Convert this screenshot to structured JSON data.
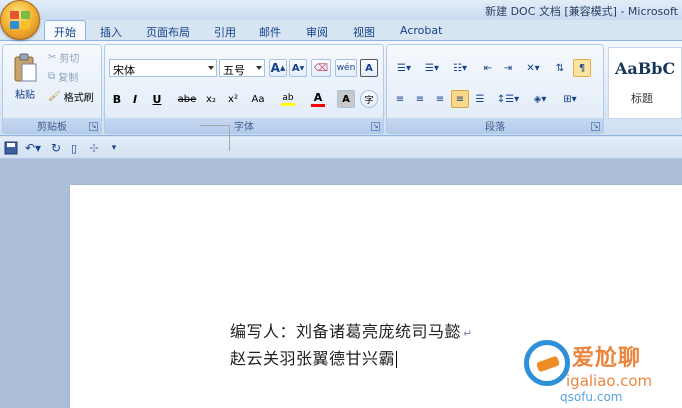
{
  "window": {
    "title": "新建 DOC 文档 [兼容模式] - Microsoft"
  },
  "tabs": [
    "开始",
    "插入",
    "页面布局",
    "引用",
    "邮件",
    "审阅",
    "视图",
    "Acrobat"
  ],
  "clipboard": {
    "paste": "粘贴",
    "cut": "剪切",
    "copy": "复制",
    "format_painter": "格式刷",
    "label": "剪贴板"
  },
  "font": {
    "name": "宋体",
    "size": "五号",
    "grow": "A",
    "shrink": "A",
    "clear": "A",
    "pinyin": "wén",
    "char_border": "A",
    "bold": "B",
    "italic": "I",
    "underline": "U",
    "strike": "abe",
    "subscript": "x₂",
    "superscript": "x²",
    "change_case": "Aa",
    "highlight": "ab",
    "font_color": "A",
    "char_shading": "A",
    "enclose": "字",
    "label": "字体"
  },
  "paragraph": {
    "label": "段落"
  },
  "styles": {
    "sample": "AaBbC",
    "name": "标题"
  },
  "document": {
    "line1": "编写人：刘备诸葛亮庞统司马懿",
    "line2": "赵云关羽张翼德甘兴霸"
  },
  "watermark": {
    "brand": "爱尬聊",
    "url": "igaliao.com",
    "url2": "qsofu.com"
  },
  "colors": {
    "highlight": "#ffff00",
    "font_color": "#ff0000",
    "accent": "#15428b"
  }
}
